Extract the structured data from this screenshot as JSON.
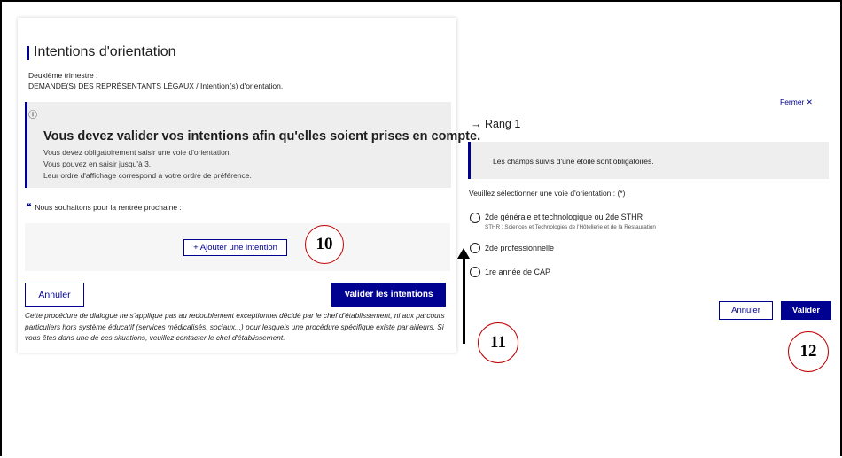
{
  "left_panel": {
    "title": "Intentions d'orientation",
    "period": "Deuxième trimestre :",
    "breadcrumb": "DEMANDE(S) DES REPRÉSENTANTS LÉGAUX / Intention(s) d'orientation.",
    "info_icon": "ⓘ",
    "alert_heading": "Vous devez valider vos intentions afin qu'elles soient prises en compte.",
    "alert_lines": [
      "Vous devez obligatoirement saisir une voie d'orientation.",
      "Vous pouvez en saisir jusqu'à 3.",
      "Leur ordre d'affichage correspond à votre ordre de préférence."
    ],
    "quote_mark": "❝",
    "wish_label": "Nous souhaitons pour la rentrée prochaine :",
    "add_intention_label": "+ Ajouter une intention",
    "cancel_label": "Annuler",
    "validate_label": "Valider les intentions",
    "note": "Cette procédure de dialogue ne s'applique pas au redoublement exceptionnel décidé par le chef d'établissement, ni aux parcours particuliers hors système éducatif (services médicalisés, sociaux...) pour lesquels une procédure spécifique existe par ailleurs. Si vous êtes dans une de ces situations, veuillez contacter le chef d'établissement."
  },
  "right_panel": {
    "close_label": "Fermer ✕",
    "rank_title": "→ Rang 1",
    "required_note": "Les champs suivis d'une étoile sont obligatoires.",
    "select_label": "Veuillez sélectionner une voie d'orientation : (*)",
    "options": [
      {
        "label": "2de générale et technologique ou 2de STHR",
        "sub": "STHR : Sciences et Technologies de l'Hôtellerie et de la Restauration"
      },
      {
        "label": "2de professionnelle",
        "sub": ""
      },
      {
        "label": "1re année de CAP",
        "sub": ""
      }
    ],
    "cancel_label": "Annuler",
    "validate_label": "Valider"
  },
  "annotations": {
    "callout_10": "10",
    "callout_11": "11",
    "callout_12": "12"
  },
  "colors": {
    "primary": "#000091",
    "alert_bg": "#eeeeee",
    "callout_border": "#c00000"
  }
}
